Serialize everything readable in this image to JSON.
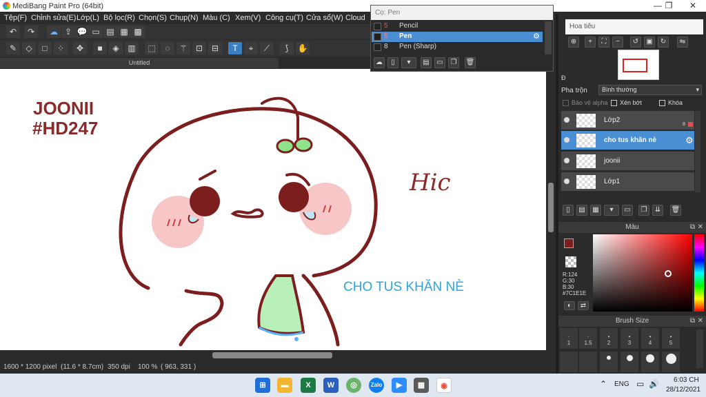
{
  "app": {
    "title": "MediBang Paint Pro (64bit)",
    "window_buttons": [
      "—",
      "❐",
      "✕"
    ]
  },
  "menu": [
    "Tệp(F)",
    "Chỉnh sửa(E)",
    "Lớp(L)",
    "Bộ lọc(R)",
    "Chọn(S)",
    "Chụp(N)",
    "Màu (C)",
    "Xem(V)",
    "Công cụ(T)",
    "Cửa sổ(W)",
    "Cloud"
  ],
  "document": {
    "tab_label": "Untitled",
    "texts": {
      "joonii": "JOONII",
      "tag": "#HD247",
      "hic": "Hic",
      "caption": "CHO TUS KHĂN NÈ"
    }
  },
  "brush_popup": {
    "header": "Cọ: Pen",
    "items": [
      {
        "size": "5",
        "label": "Pencil",
        "selected": false
      },
      {
        "size": "5",
        "label": "Pen",
        "selected": true
      },
      {
        "size": "8",
        "label": "Pen (Sharp)",
        "selected": false
      }
    ]
  },
  "navigator": {
    "header": "Hoa tiêu"
  },
  "layer_panel": {
    "blend_label": "Pha trộn",
    "blend_value": "Bình thường",
    "protect_alpha": "Bảo vệ alpha",
    "clipping": "Xén bớt",
    "lock": "Khóa",
    "opacity_short": "Đ",
    "layers": [
      {
        "name": "Lớp2",
        "selected": false,
        "badge": "8"
      },
      {
        "name": "cho tus khăn nè",
        "selected": true,
        "badge": ""
      },
      {
        "name": "joonii",
        "selected": false,
        "badge": ""
      },
      {
        "name": "Lớp1",
        "selected": false,
        "badge": ""
      }
    ]
  },
  "color_panel": {
    "header": "Màu",
    "r": "R:124",
    "g": "G:30",
    "b": "B:30",
    "hex": "#7C1E1E",
    "primary_color": "#7c1e1e"
  },
  "brush_size_panel": {
    "header": "Brush Size",
    "sizes": [
      "1",
      "1.5",
      "2",
      "3",
      "4",
      "5"
    ]
  },
  "status": {
    "pixel_size": "1600 * 1200 pixel",
    "cm_size": "(11.6 * 8.7cm)",
    "dpi": "350 dpi",
    "zoom": "100 %",
    "cursor": "( 963, 331 )"
  },
  "taskbar": {
    "language": "ENG",
    "time": "6:03 CH",
    "date": "28/12/2021"
  }
}
